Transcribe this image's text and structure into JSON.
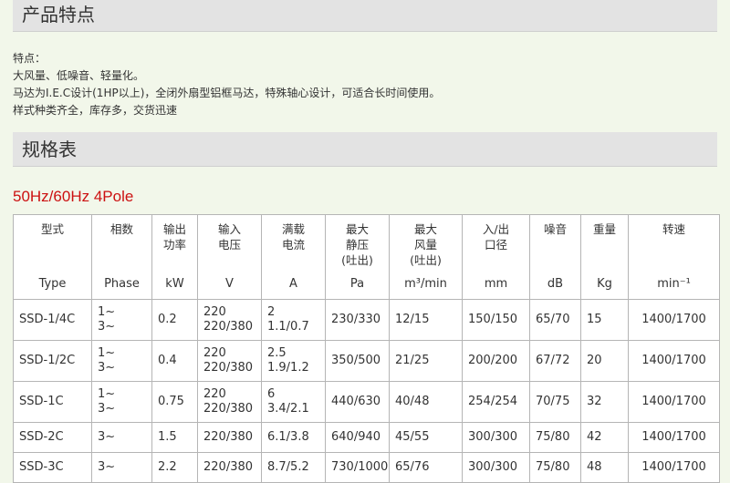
{
  "section1": {
    "title": "产品特点"
  },
  "features": [
    "特点：",
    "大风量、低噪音、轻量化。",
    "马达为I.E.C设计(1HP以上)，全闭外扇型铝框马达，特殊轴心设计，可适合长时间使用。",
    "样式种类齐全，库存多，交货迅速"
  ],
  "section2": {
    "title": "规格表"
  },
  "table_title": "50Hz/60Hz 4Pole",
  "headers": [
    {
      "zh": "型式",
      "en": "Type"
    },
    {
      "zh": "相数",
      "en": "Phase"
    },
    {
      "zh": "输出\n功率",
      "en": "kW"
    },
    {
      "zh": "输入\n电压",
      "en": "V"
    },
    {
      "zh": "满载\n电流",
      "en": "A"
    },
    {
      "zh": "最大\n静压\n(吐出)",
      "en": "Pa"
    },
    {
      "zh": "最大\n风量\n(吐出)",
      "en": "m³/min"
    },
    {
      "zh": "入/出\n口径",
      "en": "mm"
    },
    {
      "zh": "噪音",
      "en": "dB"
    },
    {
      "zh": "重量",
      "en": "Kg"
    },
    {
      "zh": "转速",
      "en": "min⁻¹"
    }
  ],
  "rows": [
    [
      "SSD-1/4C",
      "1~\n3~",
      "0.2",
      "220\n220/380",
      "2\n1.1/0.7",
      "230/330",
      "12/15",
      "150/150",
      "65/70",
      "15",
      "1400/1700"
    ],
    [
      "SSD-1/2C",
      "1~\n3~",
      "0.4",
      "220\n220/380",
      "2.5\n1.9/1.2",
      "350/500",
      "21/25",
      "200/200",
      "67/72",
      "20",
      "1400/1700"
    ],
    [
      "SSD-1C",
      "1~\n3~",
      "0.75",
      "220\n220/380",
      "6\n3.4/2.1",
      "440/630",
      "40/48",
      "254/254",
      "70/75",
      "32",
      "1400/1700"
    ],
    [
      "SSD-2C",
      "3~",
      "1.5",
      "220/380",
      "6.1/3.8",
      "640/940",
      "45/55",
      "300/300",
      "75/80",
      "42",
      "1400/1700"
    ],
    [
      "SSD-3C",
      "3~",
      "2.2",
      "220/380",
      "8.7/5.2",
      "730/1000",
      "65/76",
      "300/300",
      "75/80",
      "48",
      "1400/1700"
    ]
  ]
}
